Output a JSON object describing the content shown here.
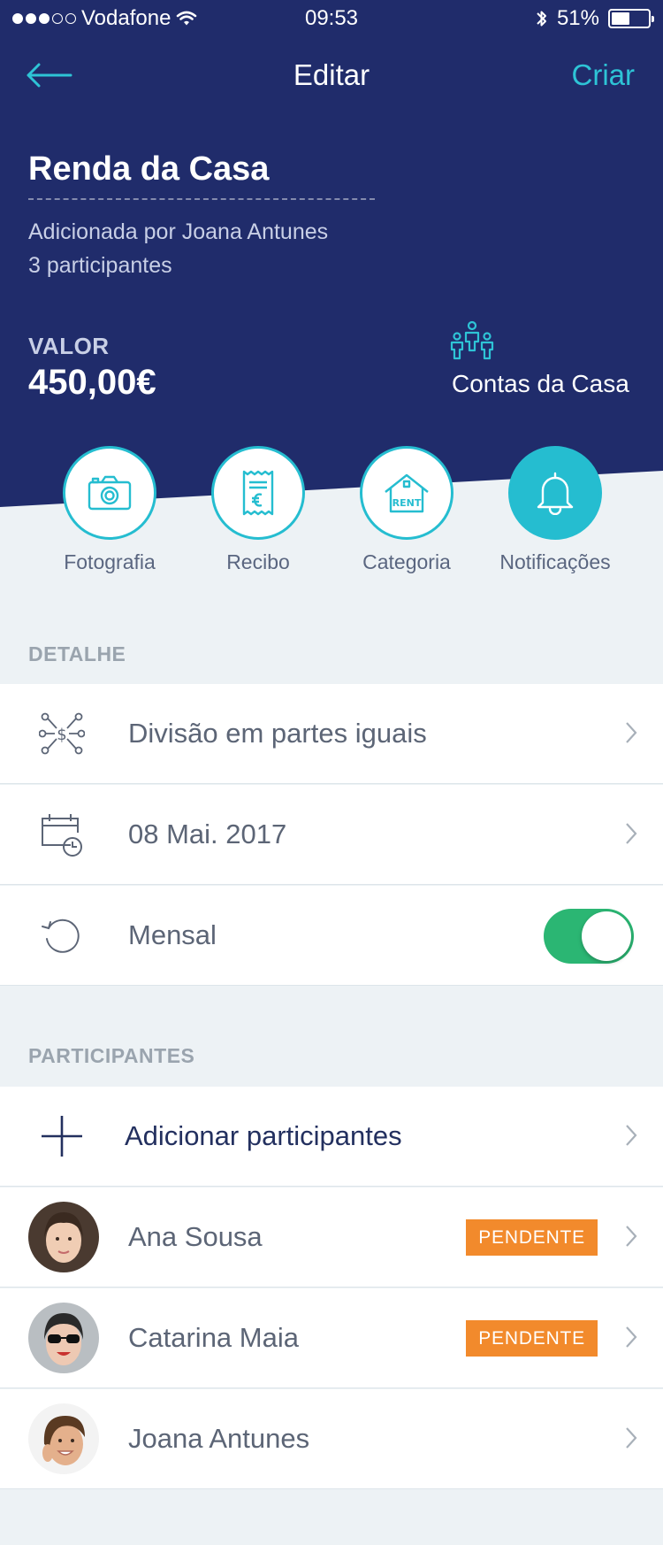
{
  "status_bar": {
    "carrier": "Vodafone",
    "time": "09:53",
    "battery": "51%",
    "signal_bars_on": 3,
    "signal_bars_total": 5,
    "battery_level": 0.51
  },
  "nav": {
    "title": "Editar",
    "action_label": "Criar"
  },
  "bill": {
    "title": "Renda da Casa",
    "added_by": "Adicionada por Joana Antunes",
    "participants_count": "3 participantes",
    "value_label": "VALOR",
    "value_amount": "450,00€",
    "group_name": "Contas da Casa"
  },
  "actions": [
    {
      "label": "Fotografia",
      "icon": "camera-icon"
    },
    {
      "label": "Recibo",
      "icon": "receipt-icon"
    },
    {
      "label": "Categoria",
      "icon": "rent-house-icon"
    },
    {
      "label": "Notificações",
      "icon": "bell-icon",
      "active": true
    }
  ],
  "detail": {
    "header": "DETALHE",
    "rows": [
      {
        "label": "Divisão em partes iguais",
        "icon": "split-icon"
      },
      {
        "label": "08 Mai. 2017",
        "icon": "calendar-clock-icon"
      },
      {
        "label": "Mensal",
        "icon": "repeat-icon",
        "toggle_on": true
      }
    ]
  },
  "participants": {
    "header": "PARTICIPANTES",
    "add_label": "Adicionar participantes",
    "list": [
      {
        "name": "Ana Sousa",
        "badge": "PENDENTE"
      },
      {
        "name": "Catarina Maia",
        "badge": "PENDENTE"
      },
      {
        "name": "Joana Antunes",
        "badge": ""
      }
    ]
  },
  "colors": {
    "header_bg": "#202C6B",
    "accent": "#25BDD0",
    "toggle_on": "#2BB673",
    "badge": "#F28A2C",
    "page_bg": "#EDF2F5"
  }
}
